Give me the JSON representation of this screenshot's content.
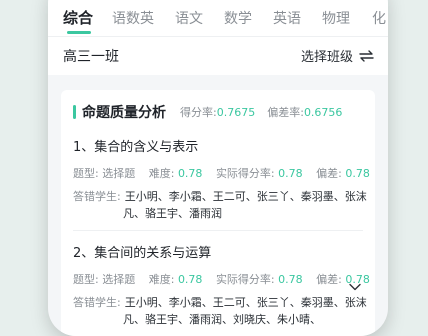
{
  "tabs": [
    "综合",
    "语数英",
    "语文",
    "数学",
    "英语",
    "物理",
    "化"
  ],
  "class_bar": {
    "class_name": "高三一班",
    "switch_label": "选择班级"
  },
  "card": {
    "title": "命题质量分析",
    "score_rate_label": "得分率:",
    "score_rate": "0.7675",
    "deviation_label": "偏差率:",
    "deviation": "0.6756",
    "questions": [
      {
        "title": "1、集合的含义与表示",
        "type_label": "题型:",
        "type": "选择题",
        "difficulty_label": "难度:",
        "difficulty": "0.78",
        "actual_label": "实际得分率:",
        "actual": "0.78",
        "bias_label": "偏差:",
        "bias": "0.78",
        "students_label": "答错学生:",
        "students": "王小明、李小霜、王二可、张三丫、秦羽墨、张沫凡、骆王宇、潘雨润"
      },
      {
        "title": "2、集合间的关系与运算",
        "type_label": "题型:",
        "type": "选择题",
        "difficulty_label": "难度:",
        "difficulty": "0.78",
        "actual_label": "实际得分率:",
        "actual": "0.78",
        "bias_label": "偏差:",
        "bias": "0.78",
        "students_label": "答错学生:",
        "students": "王小明、李小霜、王二可、张三丫、秦羽墨、张沫凡、骆王宇、潘雨润、刘晓庆、朱小晴、"
      }
    ]
  },
  "colors": {
    "accent": "#3bc7a0",
    "text": "#1f2329",
    "muted": "#8a8f95",
    "page_bg": "#f4f6f8"
  },
  "icons": {
    "switch": "swap-arrows-icon",
    "expand": "chevron-down-icon"
  }
}
